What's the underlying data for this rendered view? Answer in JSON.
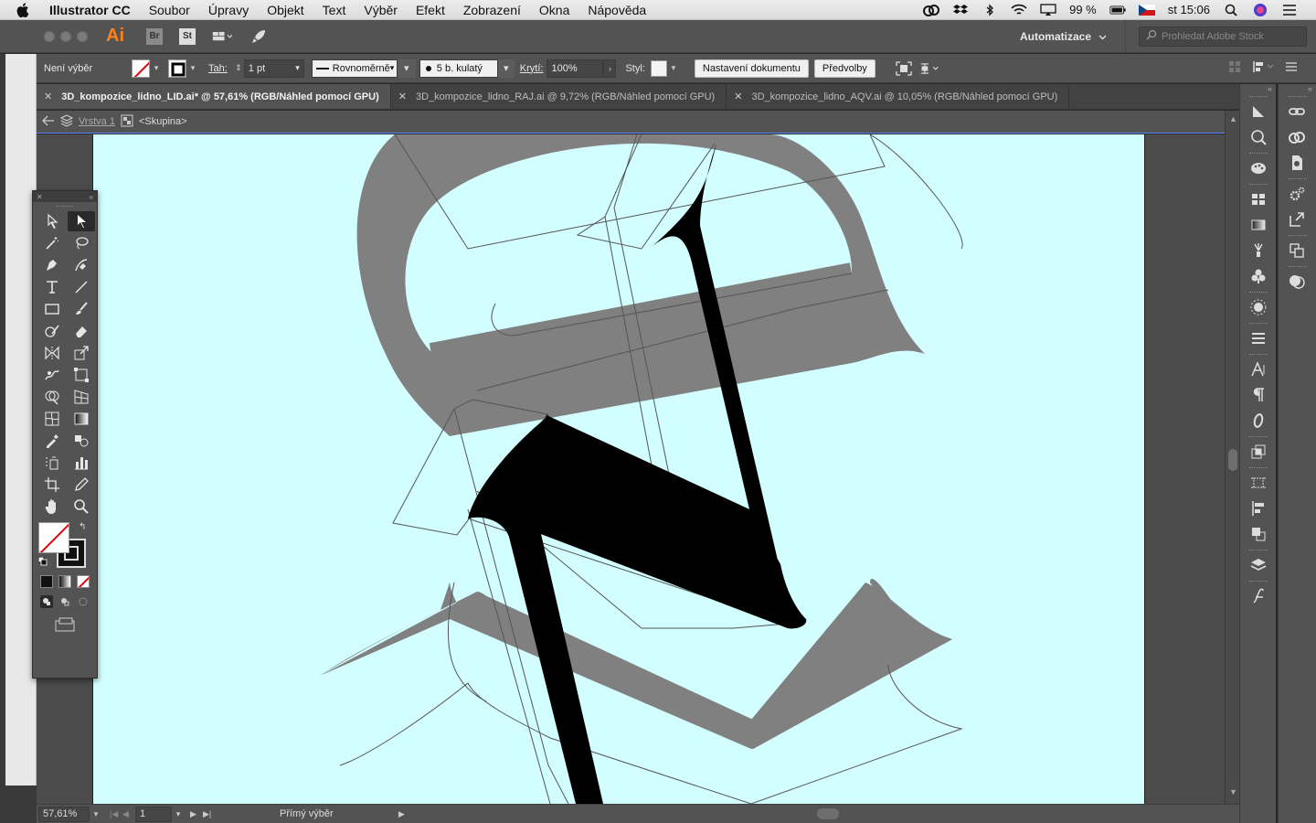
{
  "menubar": {
    "app_name": "Illustrator CC",
    "items": [
      "Soubor",
      "Úpravy",
      "Objekt",
      "Text",
      "Výběr",
      "Efekt",
      "Zobrazení",
      "Okna",
      "Nápověda"
    ],
    "battery": "99 %",
    "clock": "st 15:06"
  },
  "apptitle": {
    "logo": "Ai",
    "bridge": "Br",
    "stock": "St",
    "workspace": "Automatizace",
    "search_placeholder": "Prohledat Adobe Stock"
  },
  "control": {
    "selection_label": "Není výběr",
    "stroke_label": "Tah:",
    "stroke_value": "1 pt",
    "profile": "Rovnoměrně",
    "brush": "5 b. kulatý",
    "opacity_label": "Krytí:",
    "opacity_value": "100%",
    "style_label": "Styl:",
    "doc_setup": "Nastavení dokumentu",
    "preferences": "Předvolby"
  },
  "tabs": [
    {
      "label": "3D_kompozice_lidno_LID.ai* @ 57,61% (RGB/Náhled pomocí GPU)",
      "active": true
    },
    {
      "label": "3D_kompozice_lidno_RAJ.ai @ 9,72% (RGB/Náhled pomocí GPU)",
      "active": false
    },
    {
      "label": "3D_kompozice_lidno_AQV.ai @ 10,05% (RGB/Náhled pomocí GPU)",
      "active": false
    }
  ],
  "breadcrumb": {
    "layer": "Vrstva 1",
    "group": "<Skupina>"
  },
  "status": {
    "zoom": "57,61%",
    "page": "1",
    "tool": "Přímý výběr"
  },
  "colors": {
    "artboard": "#d2feff",
    "ui_panel": "#535353",
    "accent": "#ff7f18",
    "letter_gray": "#808080",
    "letter_black": "#000000"
  }
}
